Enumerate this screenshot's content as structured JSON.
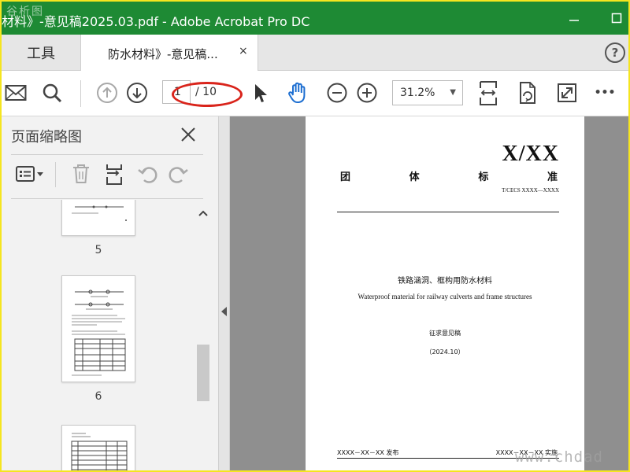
{
  "window": {
    "title": "材料》-意见稿2025.03.pdf - Adobe Acrobat Pro DC",
    "watermark_top_left": "谷析图"
  },
  "tabs": {
    "tools_label": "工具",
    "document_label": "防水材料》-意见稿...",
    "close_glyph": "×",
    "help_glyph": "?"
  },
  "toolbar": {
    "current_page": "1",
    "total_pages": "/ 10",
    "zoom_level": "31.2%",
    "more_glyph": "•••",
    "icons": [
      "mail-icon",
      "search-icon",
      "page-up-icon",
      "page-down-icon",
      "select-cursor-icon",
      "hand-tool-icon",
      "zoom-out-icon",
      "zoom-in-icon",
      "fit-width-icon",
      "rotate-page-icon",
      "fullscreen-icon",
      "more-icon"
    ],
    "highlight_color": "#d9241b"
  },
  "thumbnail_pane": {
    "title": "页面缩略图",
    "icons": [
      "options-icon",
      "delete-icon",
      "insert-page-icon",
      "undo-icon",
      "redo-icon"
    ],
    "thumbnails": [
      {
        "page_label": "5"
      },
      {
        "page_label": "6"
      },
      {
        "page_label": ""
      }
    ]
  },
  "document": {
    "standard_code": "X/XX",
    "heading_chars": [
      "团",
      "体",
      "标",
      "准"
    ],
    "standard_number": "T/CECS XXXX—XXXX",
    "title_cn": "铁路涵洞、框构用防水材料",
    "title_en": "Waterproof material for railway culverts and frame structures",
    "draft_label": "征求意见稿",
    "draft_date": "（2024.10）",
    "issue_line": "XXXX－XX－XX 发布",
    "implement_line": "XXXX－XX－XX 实施"
  },
  "watermark_bottom_right": "www.chdad",
  "colors": {
    "titlebar": "#1e8a34",
    "outer_border": "#f5e51f",
    "doc_background": "#8f8f8f"
  }
}
